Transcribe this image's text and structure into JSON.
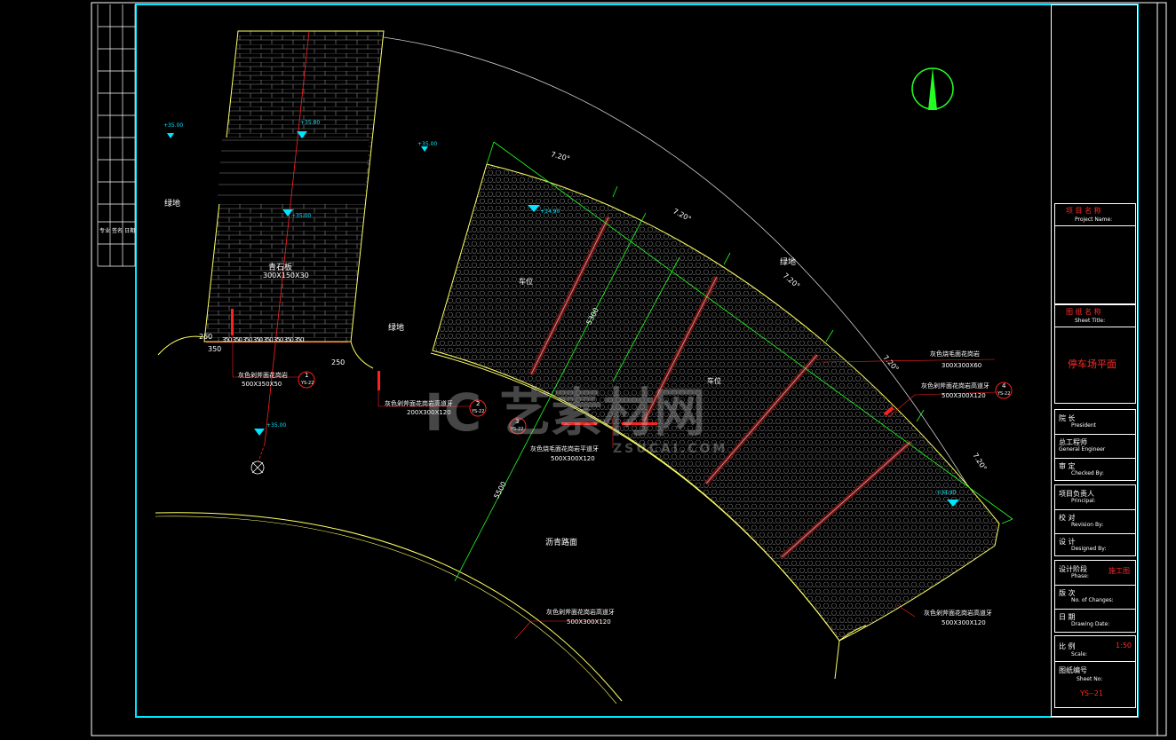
{
  "colors": {
    "frame": "#00e5ff",
    "yellow": "#ffff66",
    "green": "#22ff22",
    "red": "#ff2020",
    "white": "#ffffff",
    "cyan": "#00e5ff"
  },
  "drawing": {
    "labels": {
      "lawn_left": "绿地",
      "lawn_mid": "绿地",
      "lawn_right": "绿地",
      "bluestone": "青石板",
      "bluestone_size": "300X150X30",
      "parking_1": "车位",
      "parking_2": "车位",
      "asphalt": "沥青路面",
      "curb1_name": "灰色剁斧面花岗岩",
      "curb1_size": "500X350X50",
      "curb2_name": "灰色剁斧面花岗岩高道牙",
      "curb2_size": "200X300X120",
      "curb3_name": "灰色烧毛面花岗岩平道牙",
      "curb3_size": "500X300X120",
      "curb4_name": "灰色烧毛面花岗岩",
      "curb4_size": "300X300X60",
      "curb5_name": "灰色剁斧面花岗岩高道牙",
      "curb5_size": "500X300X120",
      "curb6_name": "灰色剁斧面花岗岩高道牙",
      "curb6_size": "500X300X120",
      "curb7_name": "灰色剁斧面花岗岩高道牙",
      "curb7_size": "500X300X120",
      "ref1": "1",
      "ref1b": "YS-22",
      "ref2": "2",
      "ref2b": "YS-22",
      "ref3": "3",
      "ref3b": "YS-22",
      "ref4": "4",
      "ref4b": "YS-22"
    },
    "dims": {
      "d250a": "250",
      "d350seq": "350 350 350 350 350 350 350 350",
      "d350b": "350",
      "d250b": "250",
      "d720a": "7.20°",
      "d720b": "7.20°",
      "d720c": "7.20°",
      "d720d": "7.20°",
      "d720e": "7.20°",
      "d5500": "5500",
      "d5300": "5300"
    },
    "levels": {
      "l1": "+35.00",
      "l2": "+35.00",
      "l3": "+35.00",
      "l4": "+35.00",
      "l5": "+34.90",
      "l6": "+35.00",
      "l7": "+34.90"
    },
    "watermark": {
      "text": "IC 艺素材网",
      "sub": "ZSUCAI.COM"
    }
  },
  "title_block": {
    "project_name_cn": "项 目 名 称",
    "project_name_en": "Project   Name:",
    "sheet_title_cn": "图 纸 名 称",
    "sheet_title_en": "Sheet   Title:",
    "sheet_title_value": "停车场平面",
    "president_cn": "院       长",
    "president_en": "President",
    "engineer_cn": "总工程师",
    "engineer_en": "General  Engineer",
    "checked_cn": "审       定",
    "checked_en": "Checked  By:",
    "principal_cn": "项目负责人",
    "principal_en": "Principal:",
    "revision_cn": "校       对",
    "revision_en": "Revision  By:",
    "designed_cn": "设       计",
    "designed_en": "Designed  By:",
    "phase_cn": "设计阶段",
    "phase_en": "Phase:",
    "phase_value": "施工图",
    "changes_cn": "版       次",
    "changes_en": "No. of Changes:",
    "date_cn": "日       期",
    "date_en": "Drawing  Date:",
    "scale_cn": "比       例",
    "scale_en": "Scale:",
    "scale_value": "1:50",
    "sheet_no_cn": "图纸编号",
    "sheet_no_en": "Sheet  No:",
    "sheet_no_value": "YS--21"
  },
  "left_strip": {
    "a": "专业",
    "b": "签名",
    "c": "日期"
  }
}
